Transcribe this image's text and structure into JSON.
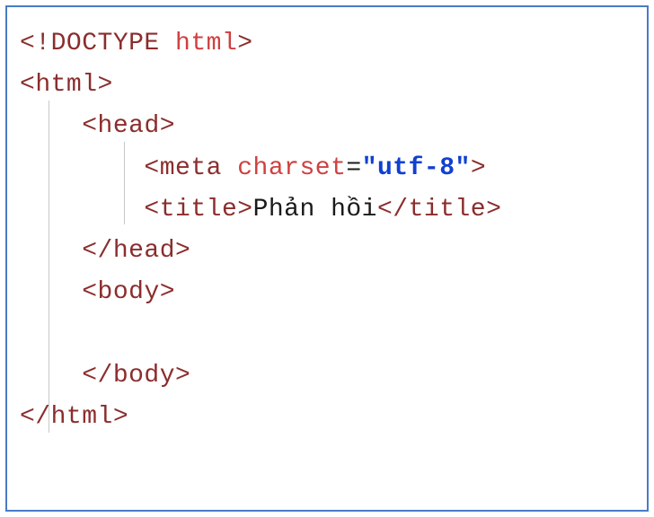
{
  "code": {
    "line1": {
      "open": "<!DOCTYPE ",
      "name": "html",
      "close": ">"
    },
    "line2": {
      "open": "<",
      "tag": "html",
      "close": ">"
    },
    "line3": {
      "indent": "    ",
      "open": "<",
      "tag": "head",
      "close": ">"
    },
    "line4": {
      "indent": "        ",
      "open": "<",
      "tag": "meta ",
      "attr": "charset",
      "eq": "=",
      "value": "\"utf-8\"",
      "close": ">"
    },
    "line5": {
      "indent": "        ",
      "open": "<",
      "tag": "title",
      "close1": ">",
      "text": "Phản hồi",
      "open2": "</",
      "tag2": "title",
      "close2": ">"
    },
    "line6": {
      "indent": "    ",
      "open": "</",
      "tag": "head",
      "close": ">"
    },
    "line7": {
      "indent": "    ",
      "open": "<",
      "tag": "body",
      "close": ">"
    },
    "line8": {
      "blank": " "
    },
    "line9": {
      "indent": "    ",
      "open": "</",
      "tag": "body",
      "close": ">"
    },
    "line10": {
      "open": "</",
      "tag": "html",
      "close": ">"
    }
  }
}
